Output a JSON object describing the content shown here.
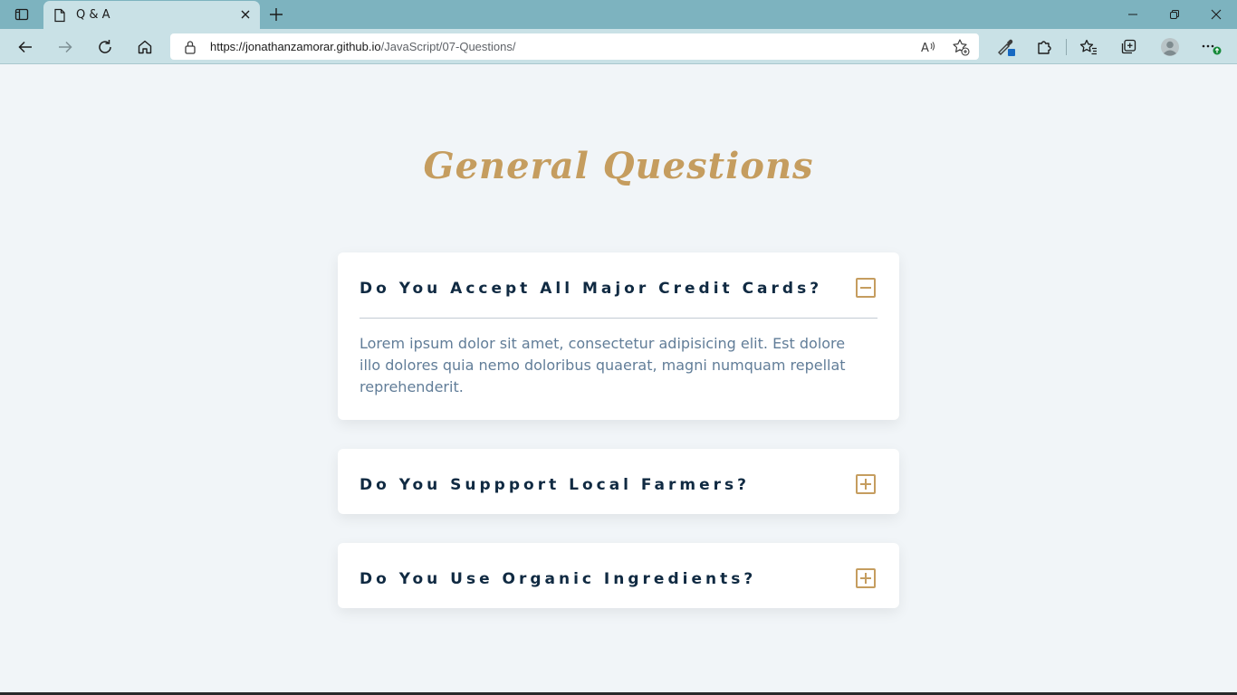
{
  "browser": {
    "tab_title": "Q & A",
    "url_host": "https://jonathanzamorar.github.io",
    "url_path": "/JavaScript/07-Questions/",
    "theme_colors": {
      "titlebar": "#7db3bf",
      "toolbar": "#c9e1e6"
    }
  },
  "page": {
    "title": "General Questions",
    "accent_color": "#c59d5f",
    "questions": [
      {
        "title": "Do You Accept All Major Credit Cards?",
        "expanded": true,
        "toggle_icon": "minus-icon",
        "answer": "Lorem ipsum dolor sit amet, consectetur adipisicing elit. Est dolore illo dolores quia nemo doloribus quaerat, magni numquam repellat reprehenderit."
      },
      {
        "title": "Do You Suppport Local Farmers?",
        "expanded": false,
        "toggle_icon": "plus-icon"
      },
      {
        "title": "Do You Use Organic Ingredients?",
        "expanded": false,
        "toggle_icon": "plus-icon"
      }
    ]
  }
}
